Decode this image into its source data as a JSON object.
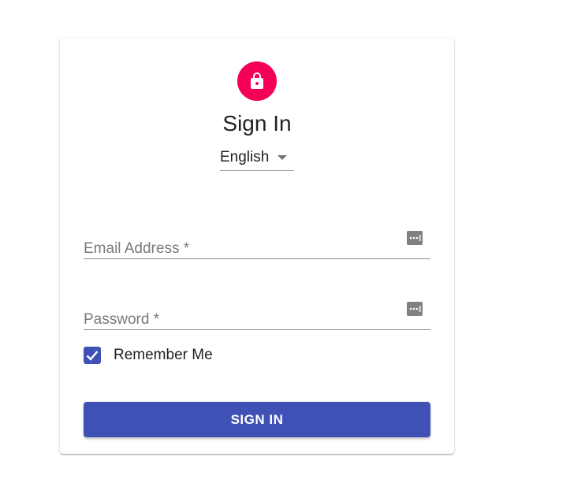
{
  "colors": {
    "avatar_bg": "#f50057",
    "primary": "#3f51b5",
    "icon_gray": "#808080"
  },
  "header": {
    "avatar_icon": "lock-icon",
    "title": "Sign In"
  },
  "language": {
    "selected": "English",
    "icon": "caret-down-icon"
  },
  "form": {
    "email": {
      "placeholder": "Email Address *",
      "value": "",
      "icon": "password-manager-icon"
    },
    "password": {
      "placeholder": "Password *",
      "value": "",
      "icon": "password-manager-icon"
    },
    "remember": {
      "label": "Remember Me",
      "checked": true
    },
    "submit_label": "SIGN IN"
  }
}
